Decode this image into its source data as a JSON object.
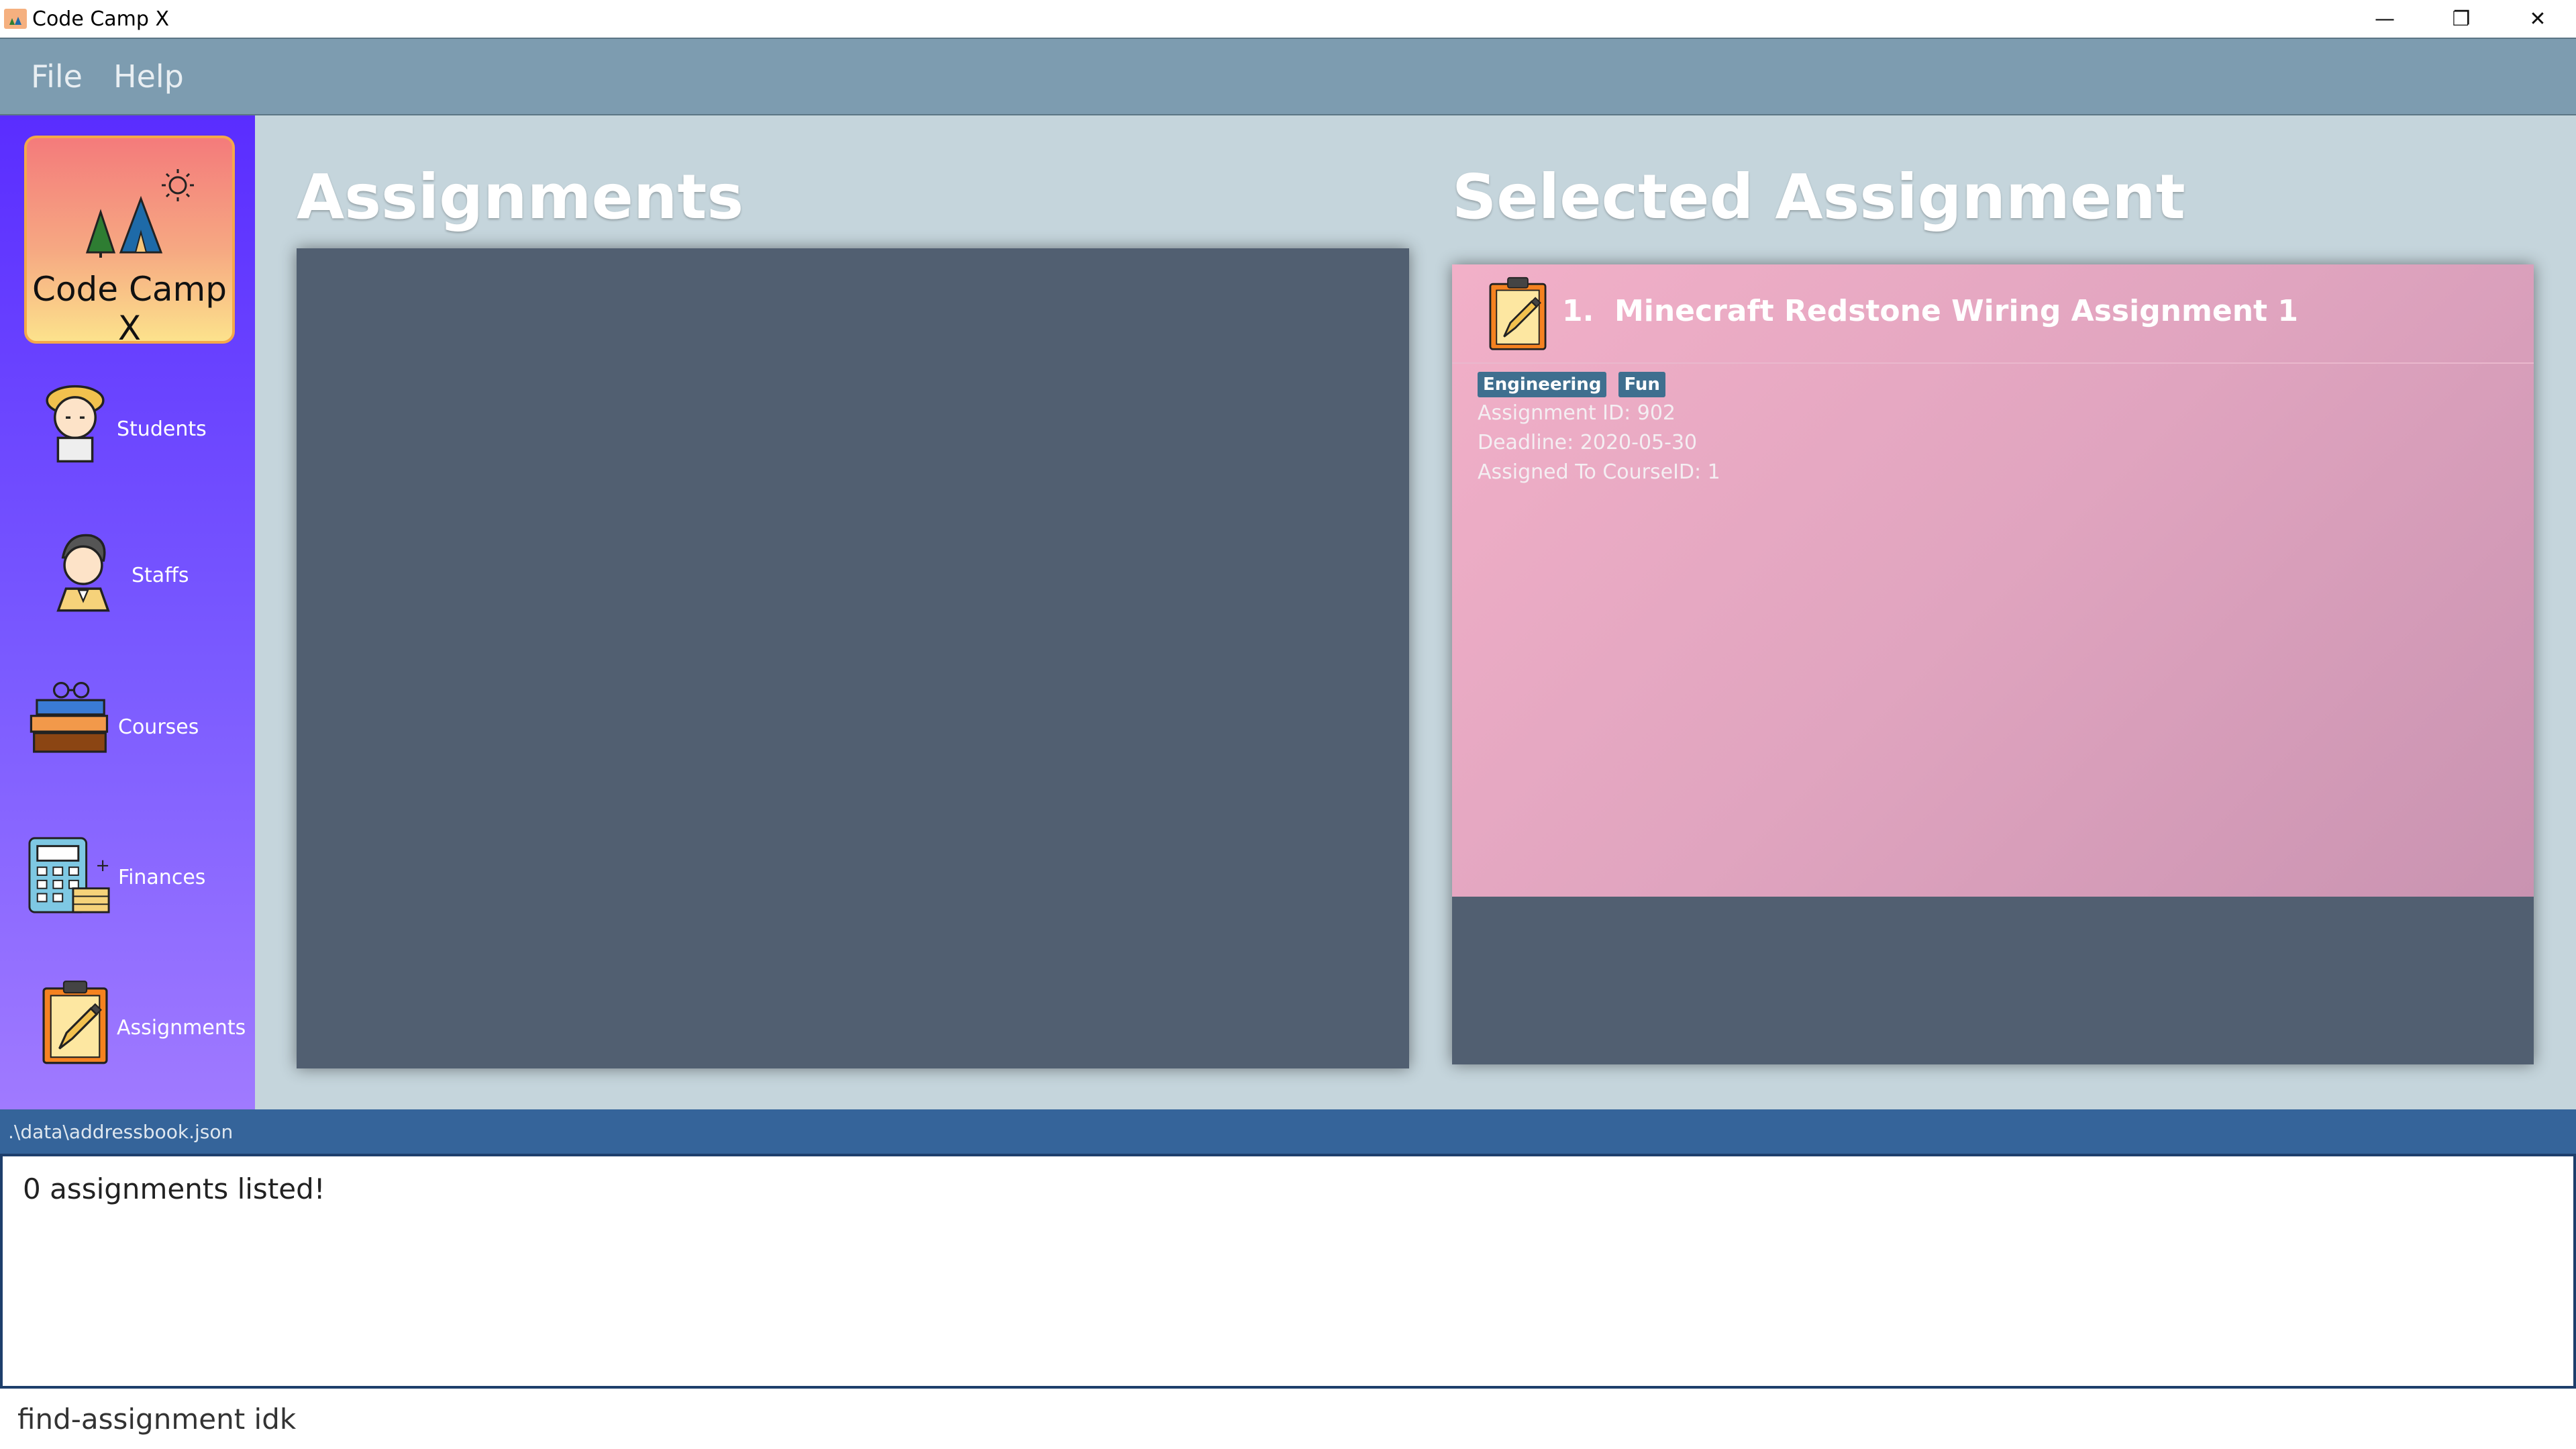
{
  "window": {
    "title": "Code Camp X",
    "controls": [
      "—",
      "❐",
      "✕"
    ]
  },
  "menu": [
    "File",
    "Help"
  ],
  "sidebar": {
    "logo_text": "Code Camp X",
    "items": [
      {
        "label": "Students",
        "icon": "student-icon"
      },
      {
        "label": "Staffs",
        "icon": "staff-icon"
      },
      {
        "label": "Courses",
        "icon": "books-icon"
      },
      {
        "label": "Finances",
        "icon": "calculator-icon"
      },
      {
        "label": "Assignments",
        "icon": "clipboard-icon"
      }
    ]
  },
  "main": {
    "list_title": "Assignments",
    "detail_title": "Selected Assignment",
    "selected": {
      "index": "1.",
      "name": "Minecraft Redstone Wiring Assignment 1",
      "tags": [
        "Engineering",
        "Fun"
      ],
      "assignment_id": "Assignment ID: 902",
      "deadline": "Deadline: 2020-05-30",
      "course": "Assigned To CourseID: 1"
    }
  },
  "status": {
    "path": ".\\data\\addressbook.json"
  },
  "result": {
    "message": "0 assignments listed!"
  },
  "command": {
    "value": "find-assignment idk"
  }
}
